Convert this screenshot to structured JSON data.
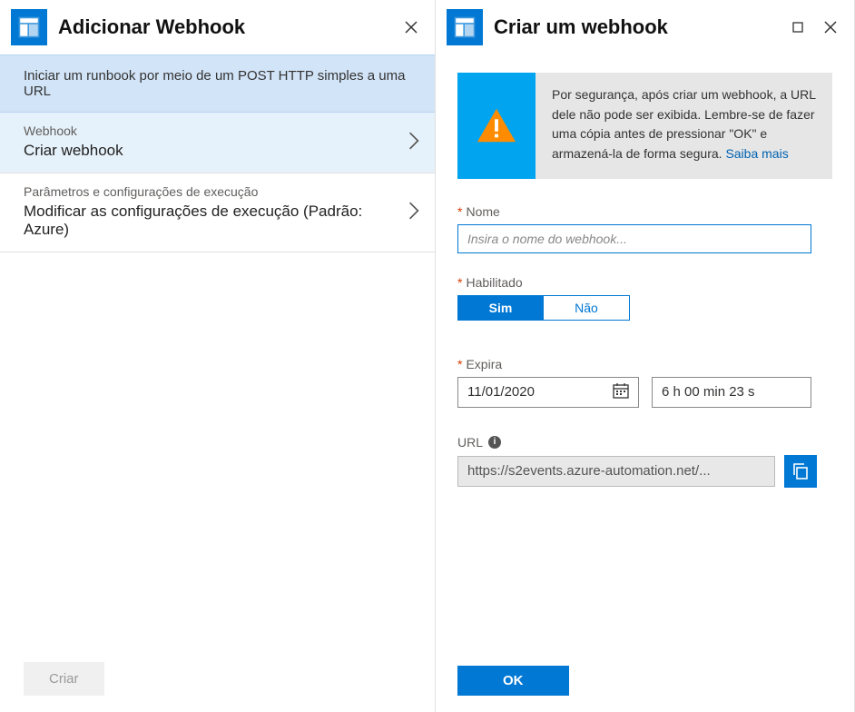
{
  "left": {
    "title": "Adicionar Webhook",
    "info": "Iniciar um runbook por meio de um POST HTTP simples a uma URL",
    "items": [
      {
        "small": "Webhook",
        "big": "Criar webhook",
        "active": true
      },
      {
        "small": "Parâmetros e configurações de execução",
        "big": "Modificar as configurações de execução (Padrão: Azure)",
        "active": false
      }
    ],
    "create_label": "Criar"
  },
  "right": {
    "title": "Criar um webhook",
    "warning": {
      "text": "Por segurança, após criar um webhook, a URL dele não pode ser exibida. Lembre-se de fazer uma cópia antes de pressionar \"OK\" e armazená-la de forma segura. ",
      "link": "Saiba mais"
    },
    "name_label": "Nome",
    "name_placeholder": "Insira o nome do webhook...",
    "enabled_label": "Habilitado",
    "toggle_yes": "Sim",
    "toggle_no": "Não",
    "toggle_value": "Sim",
    "expires_label": "Expira",
    "expires_date": "11/01/2020",
    "expires_time": "6 h 00 min 23 s",
    "url_label": "URL",
    "url_value": "https://s2events.azure-automation.net/...",
    "ok_label": "OK"
  }
}
